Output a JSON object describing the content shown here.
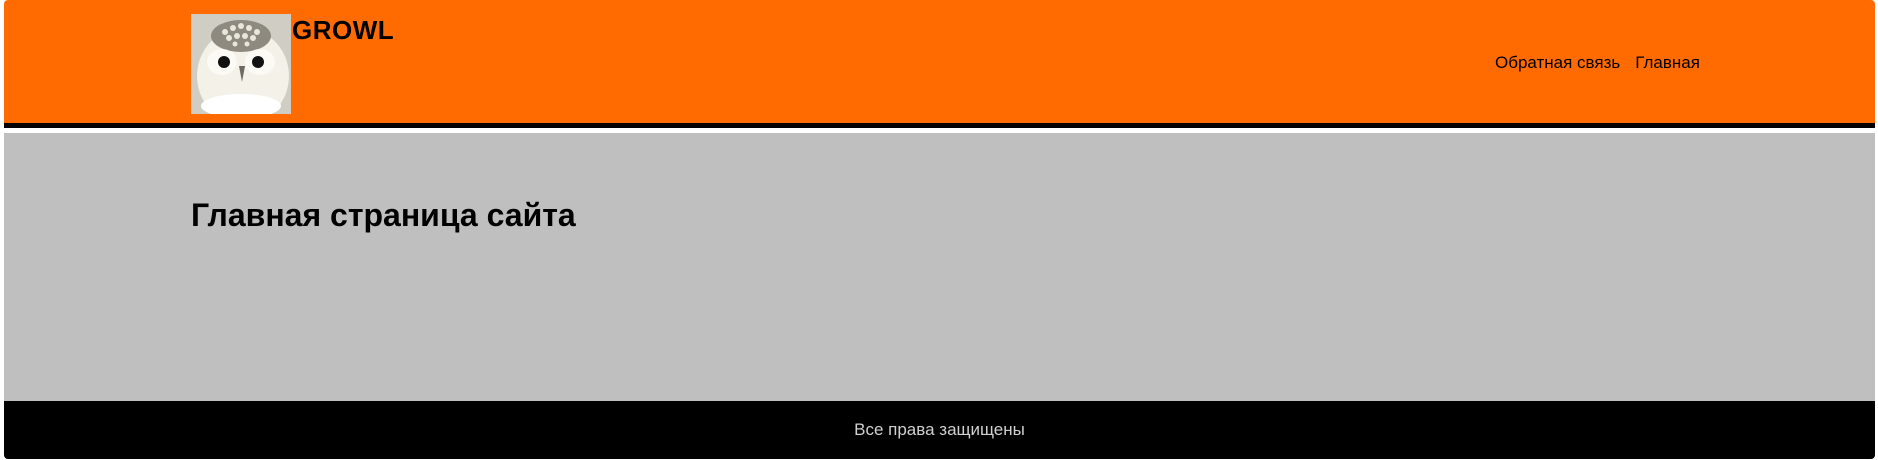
{
  "header": {
    "site_title": "GROWL",
    "logo_icon": "owl-photo",
    "nav": [
      {
        "label": "Обратная связь"
      },
      {
        "label": "Главная"
      }
    ]
  },
  "main": {
    "heading": "Главная страница сайта"
  },
  "footer": {
    "copyright": "Все права защищены"
  },
  "colors": {
    "header_bg": "#ff6b00",
    "main_bg": "#bfbfbf",
    "footer_bg": "#000000"
  }
}
